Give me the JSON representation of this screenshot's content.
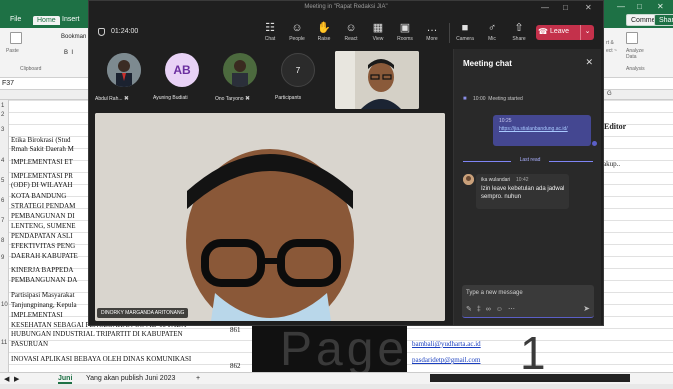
{
  "excel": {
    "ribbon_tabs": [
      "File",
      "Home",
      "Insert"
    ],
    "ribbon_items": {
      "paste": "Paste",
      "font": "Bookman",
      "clipboard": "Clipboard"
    },
    "name_box": "F37",
    "right_buttons": {
      "comments": "Comments",
      "share": "Share"
    },
    "right_ribbon": {
      "sort": "rt &",
      "select": "ect ~",
      "analyze": "Analyze Data",
      "analysis": "Analysis"
    },
    "col_g": "G",
    "editor": "Editor",
    "akup": "akup..",
    "rows": [
      {
        "num": "1",
        "text": ""
      },
      {
        "num": "2",
        "text": ""
      },
      {
        "num": "3",
        "text": "Etika Birokrasi (Stud"
      },
      {
        "num": "",
        "text": "Rmah Sakit Daerah M"
      },
      {
        "num": "4",
        "text": "IMPLEMENTASI ET"
      },
      {
        "num": "5",
        "text": "IMPLEMENTASI PR"
      },
      {
        "num": "",
        "text": "(ODF) DI WILAYAH"
      },
      {
        "num": "6",
        "text": "KOTA BANDUNG"
      },
      {
        "num": "",
        "text": "STRATEGI PENDAM"
      },
      {
        "num": "7",
        "text": "PEMBANGUNAN DI"
      },
      {
        "num": "",
        "text": "LENTENG, SUMENE"
      },
      {
        "num": "8",
        "text": "PENDAPATAN ASLI"
      },
      {
        "num": "",
        "text": "EFEKTIVITAS PENG"
      },
      {
        "num": "9",
        "text": "DAERAH KABUPATE"
      },
      {
        "num": "",
        "text": "KINERJA BAPPEDA"
      },
      {
        "num": "",
        "text": "PEMBANGUNAN DA"
      },
      {
        "num": "",
        "text": "Partisipasi Masyarakat"
      },
      {
        "num": "10",
        "text": "Tanjungpinang, Kepula"
      },
      {
        "num": "",
        "text": "IMPLEMENTASI"
      },
      {
        "num": "",
        "text": "KESEHATAN SEBAGAI PENCEGAHAN COVID-19 PADA"
      },
      {
        "num": "",
        "text": "HUBUNGAN INDUSTRIAL TRIPARTIT DI KABUPATEN"
      },
      {
        "num": "11",
        "text": "PASURUAN"
      },
      {
        "num": "",
        "text": ""
      },
      {
        "num": "",
        "text": "INOVASI APLIKASI BEBAYA OLEH DINAS KOMUNIKASI"
      }
    ],
    "num_861": "861",
    "num_862": "862",
    "link1": "bambali@yudharta.ac.id",
    "link2": "pasdaridetp@gmail.com",
    "sheets": [
      "Juni",
      "Yang akan publish Juni 2023"
    ],
    "big_text": "Page",
    "big_one": "1"
  },
  "teams": {
    "window_title": "Meeting in \"Rapat Redaksi JIA\"",
    "timer": "01:24:00",
    "toolbar": [
      {
        "label": "Chat",
        "icon": "chat-icon",
        "glyph": "☷"
      },
      {
        "label": "People",
        "icon": "people-icon",
        "glyph": "☺"
      },
      {
        "label": "Raise",
        "icon": "raise-hand-icon",
        "glyph": "✋"
      },
      {
        "label": "React",
        "icon": "react-icon",
        "glyph": "☺"
      },
      {
        "label": "View",
        "icon": "view-icon",
        "glyph": "▦"
      },
      {
        "label": "Rooms",
        "icon": "rooms-icon",
        "glyph": "▣"
      },
      {
        "label": "More",
        "icon": "more-icon",
        "glyph": "…"
      }
    ],
    "media": [
      {
        "label": "Camera",
        "icon": "camera-icon",
        "glyph": "■"
      },
      {
        "label": "Mic",
        "icon": "mic-icon",
        "glyph": "♂"
      },
      {
        "label": "Share",
        "icon": "share-icon",
        "glyph": "⇧"
      }
    ],
    "leave_label": "Leave",
    "participants": [
      {
        "name": "Abdul Rah...",
        "initials": "",
        "muted": true
      },
      {
        "name": "Ayuning Budiati",
        "initials": "AB",
        "muted": false
      },
      {
        "name": "Ono Taryono",
        "initials": "",
        "muted": true
      },
      {
        "name": "Participants",
        "initials": "7",
        "muted": false
      }
    ],
    "speaker_name": "DINORKY MARGANDA ARITONANG"
  },
  "chat": {
    "title": "Meeting chat",
    "meeting_started_time": "10:00",
    "meeting_started_text": "Meeting started",
    "bubble_time": "10:25",
    "bubble_link": "https://jia.stialanbandung.ac.id/",
    "last_read": "Last read",
    "message": {
      "sender": "ika wulandari",
      "time": "10:42",
      "text": "Izin leave kebetulan ada jadwal sempro. nuhun"
    },
    "composer_placeholder": "Type a new message"
  },
  "colors": {
    "excel_green": "#1e7145",
    "leave_red": "#c4314b",
    "teams_purple": "#444791",
    "chat_panel": "#292929"
  }
}
